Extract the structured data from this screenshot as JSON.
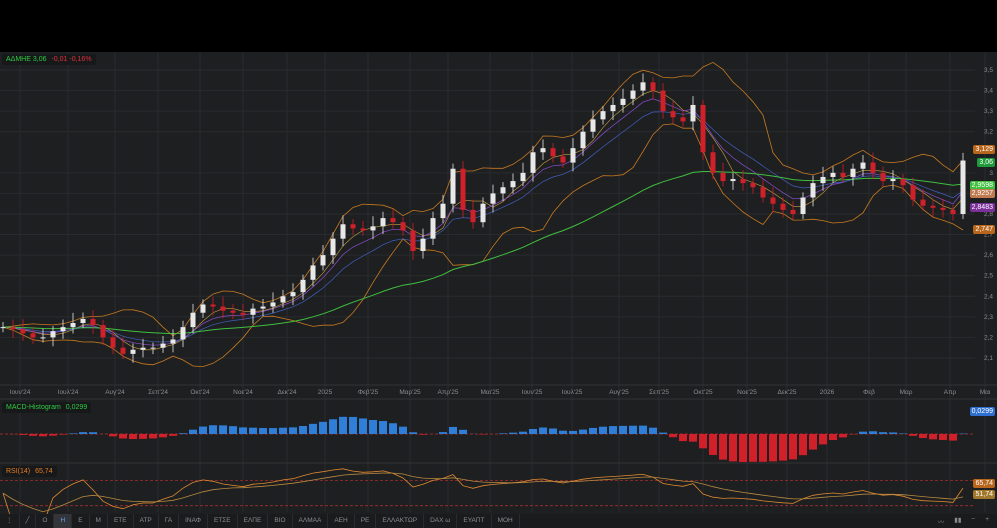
{
  "price_legend": {
    "symbol": "ΑΔΜΗΕ",
    "last": "3,06",
    "change": "-0,01",
    "change_pct": "-0,16%"
  },
  "macd_legend": {
    "label": "MACD-Histogram",
    "value": "0,0299"
  },
  "rsi_legend": {
    "label": "RSI(14)",
    "value": "65,74"
  },
  "colors": {
    "up": "#e8e8e8",
    "down": "#d0202a",
    "bands": "#c87a20",
    "ma_long": "#3fbf3f",
    "ma_purple": "#8a4fd0",
    "ma_blue": "#4060c0",
    "macd_pos": "#2f7fd8",
    "macd_neg": "#d0202a",
    "rsi": "#e08a30",
    "rsi_signal": "#b88a40"
  },
  "chart_data": {
    "type": "candlestick",
    "closes": [
      2.25,
      2.24,
      2.22,
      2.2,
      2.2,
      2.23,
      2.25,
      2.27,
      2.29,
      2.26,
      2.2,
      2.15,
      2.12,
      2.14,
      2.15,
      2.15,
      2.17,
      2.19,
      2.25,
      2.32,
      2.36,
      2.35,
      2.33,
      2.32,
      2.31,
      2.34,
      2.35,
      2.37,
      2.4,
      2.42,
      2.48,
      2.55,
      2.6,
      2.68,
      2.75,
      2.73,
      2.72,
      2.74,
      2.78,
      2.76,
      2.72,
      2.62,
      2.68,
      2.78,
      2.85,
      3.02,
      2.82,
      2.76,
      2.85,
      2.9,
      2.93,
      2.96,
      3.0,
      3.1,
      3.12,
      3.08,
      3.05,
      3.12,
      3.2,
      3.26,
      3.3,
      3.33,
      3.36,
      3.4,
      3.44,
      3.4,
      3.3,
      3.27,
      3.25,
      3.33,
      3.1,
      3.0,
      2.96,
      2.97,
      2.95,
      2.93,
      2.88,
      2.85,
      2.82,
      2.8,
      2.88,
      2.95,
      2.98,
      3.0,
      2.98,
      3.02,
      3.05,
      3.0,
      2.96,
      2.97,
      2.94,
      2.87,
      2.84,
      2.83,
      2.82,
      2.8,
      3.06
    ],
    "ylim": [
      2.0,
      3.6
    ],
    "y_ticks": [
      "3,5",
      "3,4",
      "3,3",
      "3,2",
      "3",
      "2,9",
      "2,8",
      "2,7",
      "2,6",
      "2,5",
      "2,4",
      "2,3",
      "2,2",
      "2,1"
    ],
    "x_ticks": [
      "Ιουν'24",
      "Ιουλ'24",
      "Αυγ'24",
      "Σεπ'24",
      "Οκτ'24",
      "Νοε'24",
      "Δεκ'24",
      "2025",
      "Φεβ'25",
      "Μαρ'25",
      "Απρ'25",
      "Μαι'25",
      "Ιουν'25",
      "Ιουλ'25",
      "Αυγ'25",
      "Σεπ'25",
      "Οκτ'25",
      "Νοε'25",
      "Δεκ'25",
      "2026",
      "Φεβ",
      "Μαρ",
      "Απρ",
      "Μαι"
    ],
    "price_badges": [
      {
        "value": "3,129",
        "color": "#b8661c"
      },
      {
        "value": "3,06",
        "color": "#1f9a3a"
      },
      {
        "value": "2,9598",
        "color": "#3fbf3f"
      },
      {
        "value": "2,9257",
        "color": "#c07a50"
      },
      {
        "value": "2,8483",
        "color": "#7a2f9a"
      },
      {
        "value": "2,747",
        "color": "#b8661c"
      }
    ],
    "macd_badge": {
      "value": "0,0299",
      "color": "#2f6fd0"
    },
    "rsi_badges": [
      {
        "value": "65,74",
        "color": "#b8661c"
      },
      {
        "value": "51,74",
        "color": "#a0782c"
      }
    ]
  },
  "toolbar": {
    "items": [
      "Ο",
      "Η",
      "Ε",
      "Μ",
      "ΕΤΕ",
      "ΑΤΡ",
      "ΓΑ",
      "ΙΝΑΦ",
      "ΕΤΣΕ",
      "ΕΛΠΕ",
      "ΒΙΟ",
      "ΑΛΜΑΑ",
      "ΑΕΗ",
      "ΡΕ",
      "ΕΛΛΑΚΤΩΡ",
      "DAX ω",
      "ΕΥΑΠΤ",
      "ΜΟΗ"
    ],
    "active": "Η"
  }
}
